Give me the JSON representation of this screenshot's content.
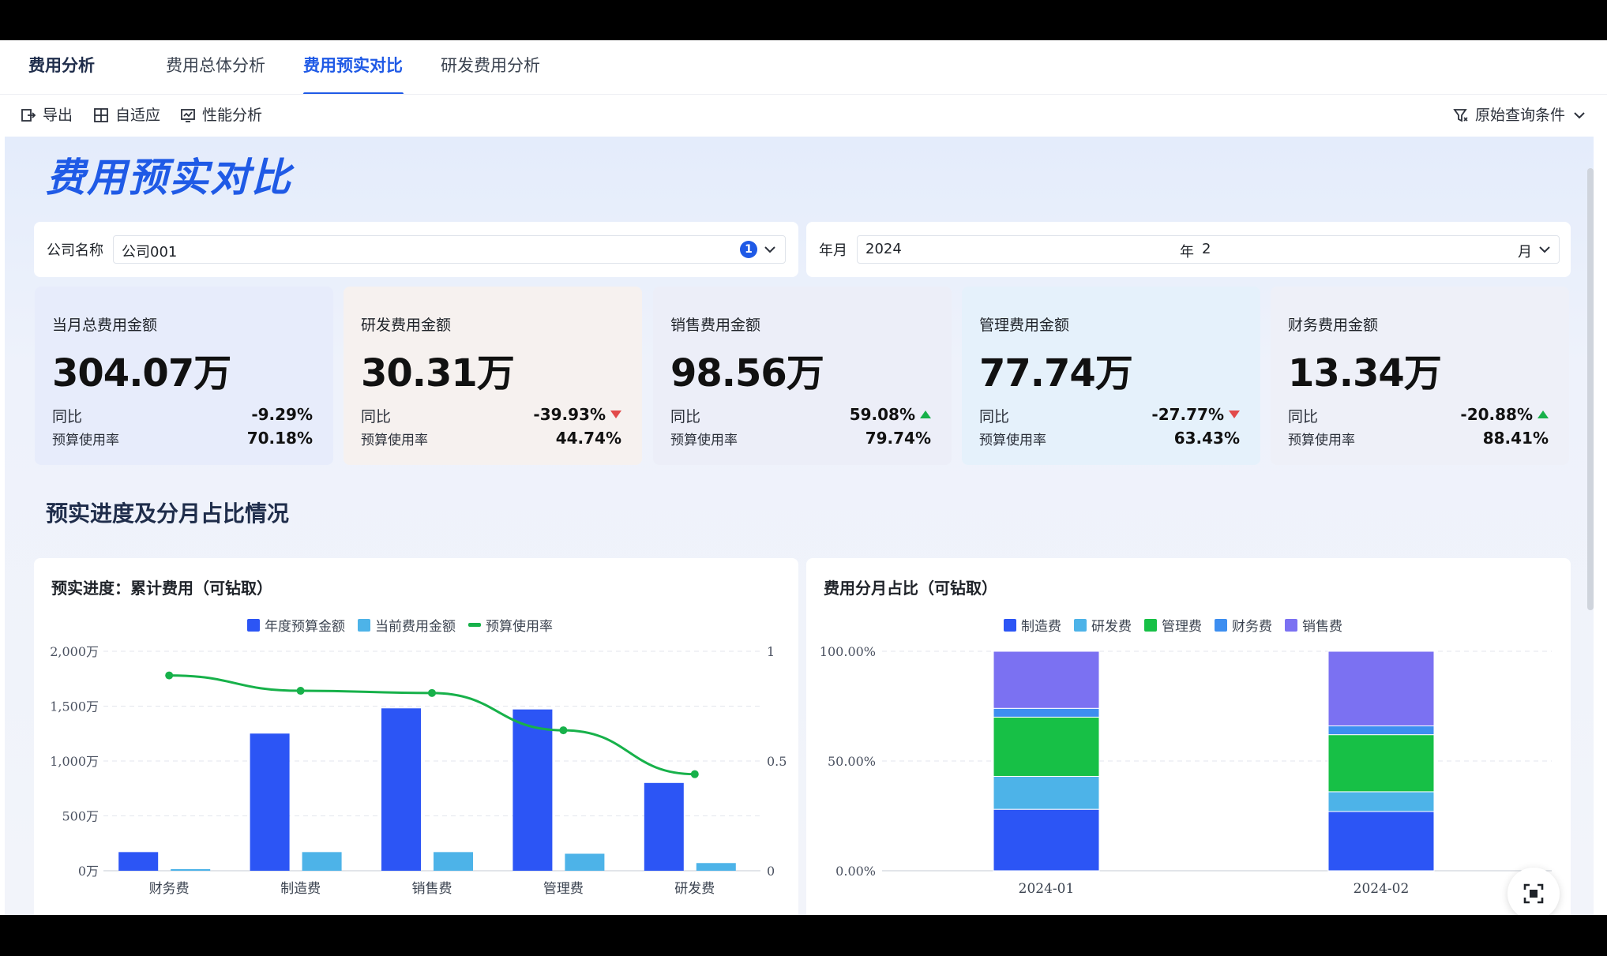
{
  "nav": {
    "brand": "费用分析",
    "tabs": [
      {
        "label": "费用总体分析"
      },
      {
        "label": "费用预实对比"
      },
      {
        "label": "研发费用分析"
      }
    ]
  },
  "toolbar": {
    "export_label": "导出",
    "adaptive_label": "自适应",
    "perf_label": "性能分析",
    "query_label": "原始查询条件"
  },
  "page_title": "费用预实对比",
  "filters": {
    "company": {
      "label": "公司名称",
      "value": "公司001",
      "count": "1"
    },
    "period": {
      "label": "年月",
      "year": "2024",
      "year_unit": "年",
      "month": "2",
      "month_unit": "月"
    }
  },
  "kpis": [
    {
      "title": "当月总费用金额",
      "value": "304.07万",
      "yoy_label": "同比",
      "yoy": "-9.29%",
      "trend": "none",
      "usage_label": "预算使用率",
      "usage": "70.18%"
    },
    {
      "title": "研发费用金额",
      "value": "30.31万",
      "yoy_label": "同比",
      "yoy": "-39.93%",
      "trend": "down",
      "usage_label": "预算使用率",
      "usage": "44.74%"
    },
    {
      "title": "销售费用金额",
      "value": "98.56万",
      "yoy_label": "同比",
      "yoy": "59.08%",
      "trend": "up",
      "usage_label": "预算使用率",
      "usage": "79.74%"
    },
    {
      "title": "管理费用金额",
      "value": "77.74万",
      "yoy_label": "同比",
      "yoy": "-27.77%",
      "trend": "down",
      "usage_label": "预算使用率",
      "usage": "63.43%"
    },
    {
      "title": "财务费用金额",
      "value": "13.34万",
      "yoy_label": "同比",
      "yoy": "-20.88%",
      "trend": "up",
      "usage_label": "预算使用率",
      "usage": "88.41%"
    }
  ],
  "section_title": "预实进度及分月占比情况",
  "colors": {
    "primary": "#1f5ae6",
    "bar_budget": "#2c55f5",
    "bar_actual": "#4db3e8",
    "line_usage": "#17b14a",
    "stack_manufacture": "#2c55f5",
    "stack_rd": "#4db3e8",
    "stack_mgmt": "#17c046",
    "stack_finance": "#3d8ef0",
    "stack_sales": "#7b71f2"
  },
  "chart_data": [
    {
      "type": "bar",
      "title": "预实进度：累计费用（可钻取）",
      "categories": [
        "财务费",
        "制造费",
        "销售费",
        "管理费",
        "研发费"
      ],
      "series": [
        {
          "name": "年度预算金额",
          "values": [
            170,
            1250,
            1480,
            1470,
            800
          ]
        },
        {
          "name": "当前费用金额",
          "values": [
            15,
            170,
            170,
            155,
            70
          ]
        },
        {
          "name": "预算使用率",
          "type": "line",
          "axis": "right",
          "values": [
            0.89,
            0.82,
            0.81,
            0.64,
            0.44
          ]
        }
      ],
      "y_ticks": [
        "2,000万",
        "1,500万",
        "1,000万",
        "500万",
        "0万"
      ],
      "ylim": [
        0,
        2000
      ],
      "y2_ticks": [
        "1",
        "0.5",
        "0"
      ],
      "y2lim": [
        0,
        1
      ],
      "grid": true,
      "legend": "top-center"
    },
    {
      "type": "bar",
      "stacked": "percent",
      "title": "费用分月占比（可钻取）",
      "categories": [
        "2024-01",
        "2024-02"
      ],
      "series": [
        {
          "name": "制造费",
          "values": [
            28,
            27
          ]
        },
        {
          "name": "研发费",
          "values": [
            15,
            9
          ]
        },
        {
          "name": "管理费",
          "values": [
            27,
            26
          ]
        },
        {
          "name": "财务费",
          "values": [
            4,
            4
          ]
        },
        {
          "name": "销售费",
          "values": [
            26,
            34
          ]
        }
      ],
      "y_ticks": [
        "100.00%",
        "50.00%",
        "0.00%"
      ],
      "ylim": [
        0,
        100
      ],
      "grid": true,
      "legend": "top-center"
    }
  ]
}
